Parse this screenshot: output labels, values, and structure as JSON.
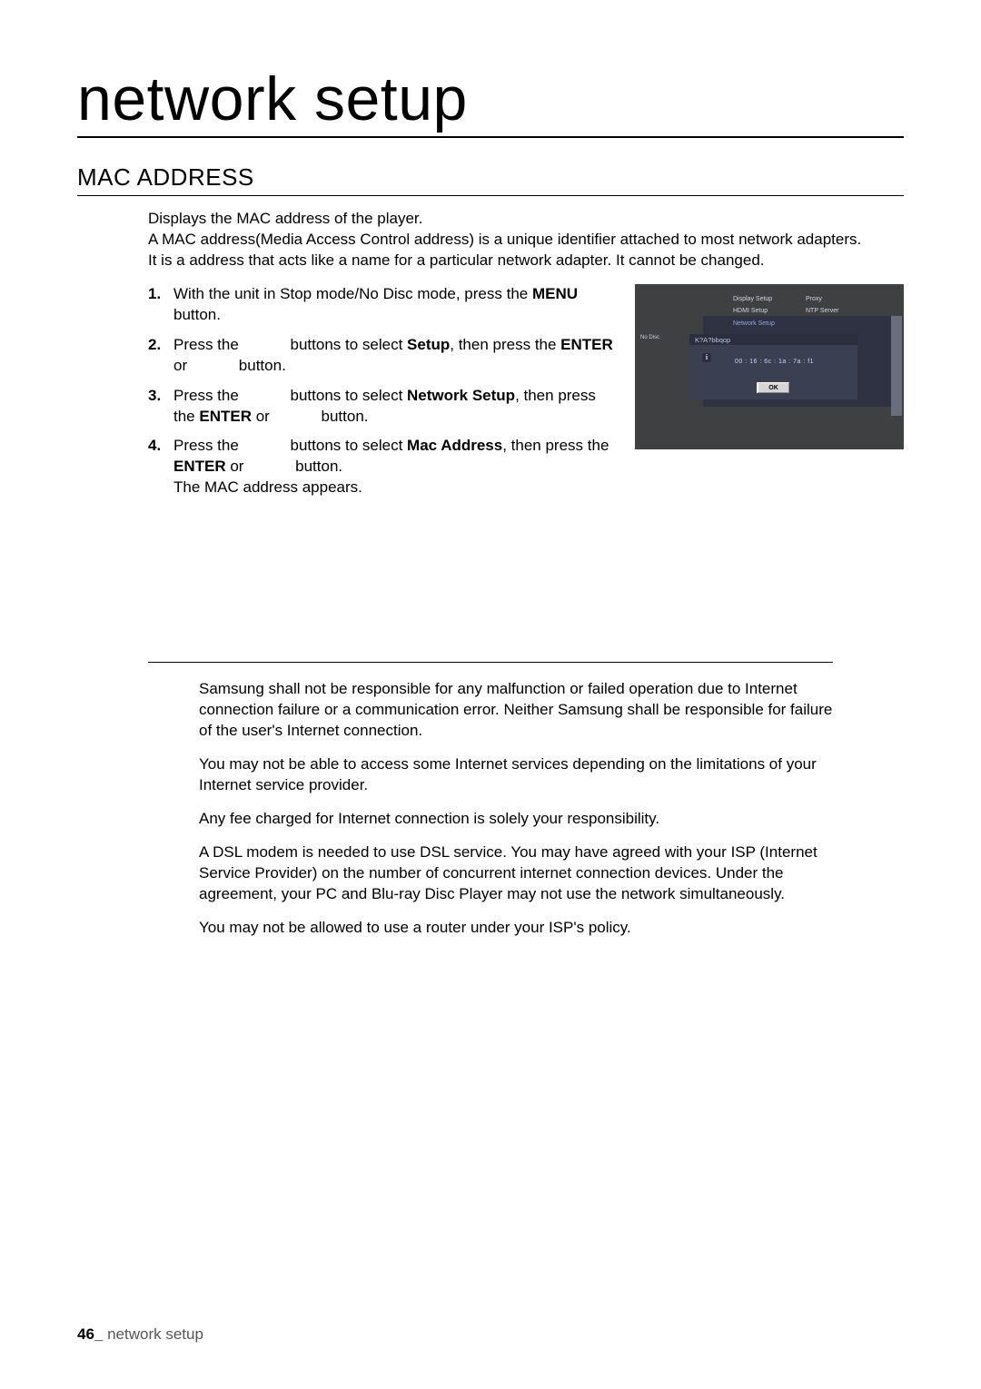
{
  "page": {
    "title": "network setup",
    "section": "MAC ADDRESS",
    "footer_page": "46_",
    "footer_label": " network setup"
  },
  "intro": {
    "l1": "Displays the MAC address of the player.",
    "l2": "A MAC address(Media Access Control address) is a unique identifier attached to most network adapters.",
    "l3": "It is a address that acts like a name for a particular network adapter. It cannot be changed."
  },
  "steps": {
    "s1a": "With the unit in Stop mode/No Disc mode, press the ",
    "s1b": "MENU",
    "s1c": " button.",
    "s2a": "Press the ",
    "s2gap": "          ",
    "s2b": " buttons to select ",
    "s2c": "Setup",
    "s2d": ", then press the ",
    "s2e": "ENTER",
    "s2f": " or ",
    "s2g": " button.",
    "s3a": "Press the ",
    "s3b": " buttons to select ",
    "s3c": "Network Setup",
    "s3d": ", then press the ",
    "s3e": "ENTER",
    "s3f": " or ",
    "s3g": " button.",
    "s4a": "Press the ",
    "s4b": " buttons to select ",
    "s4c": "Mac Address",
    "s4d": ", then press the ",
    "s4e": "ENTER",
    "s4f": " or ",
    "s4g": " button.",
    "s4h": "The MAC address appears."
  },
  "tv": {
    "no_disc": "No Disc",
    "display_setup": "Display Setup",
    "hdmi_setup": "HDMI Setup",
    "network_setup": "Network Setup",
    "proxy": "Proxy",
    "ntp": "NTP Server",
    "popup_header": "K?A?bbqop",
    "info_icon": "i",
    "mac_value": "00 : 16 : 6c : 1a : 7a : f1",
    "ok": "OK"
  },
  "notes": {
    "n1": "Samsung shall not be responsible for any malfunction or failed operation due to Internet connection failure or a communication error. Neither Samsung shall be responsible for failure of the user's Internet connection.",
    "n2": "You may not be able to access some Internet services depending on the limitations of your Internet service provider.",
    "n3": "Any fee charged for Internet connection is solely your responsibility.",
    "n4": "A DSL modem is needed to use DSL service. You may have agreed with your ISP (Internet Service Provider) on the number of concurrent internet connection devices. Under the agreement, your PC and Blu-ray Disc Player may not use the network simultaneously.",
    "n5": "You may not be allowed to use a router under your ISP's policy."
  }
}
